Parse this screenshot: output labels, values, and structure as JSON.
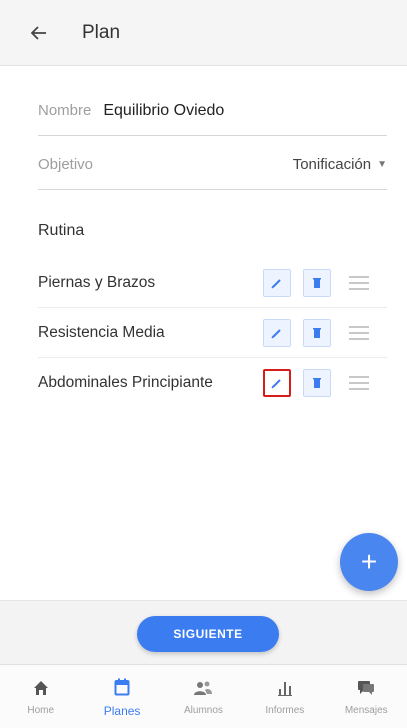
{
  "appbar": {
    "title": "Plan",
    "back_icon": "arrow-left-icon"
  },
  "form": {
    "name_label": "Nombre",
    "name_value": "Equilibrio  Oviedo",
    "goal_label": "Objetivo",
    "goal_value": "Tonificación"
  },
  "routines": {
    "title": "Rutina",
    "items": [
      {
        "name": "Piernas y Brazos"
      },
      {
        "name": "Resistencia Media"
      },
      {
        "name": "Abdominales Principiante"
      }
    ],
    "highlighted_edit_row": 2
  },
  "fab": {
    "label": "+"
  },
  "next_button": {
    "label": "SIGUIENTE"
  },
  "bottom_nav": {
    "active": "Planes",
    "items": [
      {
        "label": "Home",
        "icon": "home-icon"
      },
      {
        "label": "Planes",
        "icon": "calendar-icon"
      },
      {
        "label": "Alumnos",
        "icon": "users-icon"
      },
      {
        "label": "Informes",
        "icon": "bar-chart-icon"
      },
      {
        "label": "Mensajes",
        "icon": "chat-icon"
      }
    ]
  },
  "colors": {
    "accent": "#3b7cf0",
    "highlight_border": "#d81b1b"
  }
}
